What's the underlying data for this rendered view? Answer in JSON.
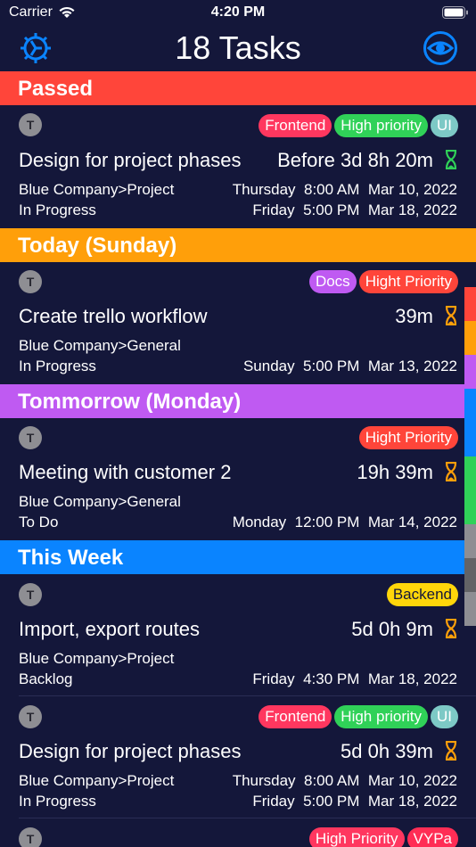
{
  "status_bar": {
    "carrier": "Carrier",
    "time": "4:20 PM"
  },
  "header": {
    "title": "18 Tasks"
  },
  "colors": {
    "passed": "#ff453a",
    "today": "#ff9f0a",
    "tomorrow": "#bf5af2",
    "week": "#0a84ff",
    "accent": "#0a84ff",
    "hourglass_ok": "#30d158",
    "hourglass_warn": "#ff9f0a",
    "tag_red": "#ff375f",
    "tag_green": "#30d158",
    "tag_teal": "#7dc9c6",
    "tag_purple": "#bf5af2",
    "tag_yellow": "#ffd60a",
    "tag_pink": "#ff2d55"
  },
  "sections": {
    "passed": "Passed",
    "today": "Today (Sunday)",
    "tomorrow": "Tommorrow (Monday)",
    "week": "This Week"
  },
  "tasks": [
    {
      "avatar": "T",
      "tags": [
        "Frontend",
        "High priority",
        "UI"
      ],
      "title": "Design for project phases",
      "time_left": "Before 3d 8h 20m",
      "project": "Blue Company>Project",
      "status": "In Progress",
      "start": "Thursday  8:00 AM  Mar 10, 2022",
      "end": "Friday  5:00 PM  Mar 18, 2022"
    },
    {
      "avatar": "T",
      "tags": [
        "Docs",
        "Hight Priority"
      ],
      "title": "Create trello workflow",
      "time_left": "39m",
      "project": "Blue Company>General",
      "status": "In Progress",
      "end": "Sunday  5:00 PM  Mar 13, 2022"
    },
    {
      "avatar": "T",
      "tags": [
        "Hight Priority"
      ],
      "title": "Meeting with customer 2",
      "time_left": "19h 39m",
      "project": "Blue Company>General",
      "status": "To Do",
      "end": "Monday  12:00 PM  Mar 14, 2022"
    },
    {
      "avatar": "T",
      "tags": [
        "Backend"
      ],
      "title": "Import, export routes",
      "time_left": "5d 0h 9m",
      "project": "Blue Company>Project",
      "status": "Backlog",
      "end": "Friday  4:30 PM  Mar 18, 2022"
    },
    {
      "avatar": "T",
      "tags": [
        "Frontend",
        "High priority",
        "UI"
      ],
      "title": "Design for project phases",
      "time_left": "5d 0h 39m",
      "project": "Blue Company>Project",
      "status": "In Progress",
      "start": "Thursday  8:00 AM  Mar 10, 2022",
      "end": "Friday  5:00 PM  Mar 18, 2022"
    },
    {
      "avatar": "T",
      "tags": [
        "High Priority",
        "VYPa"
      ]
    }
  ]
}
